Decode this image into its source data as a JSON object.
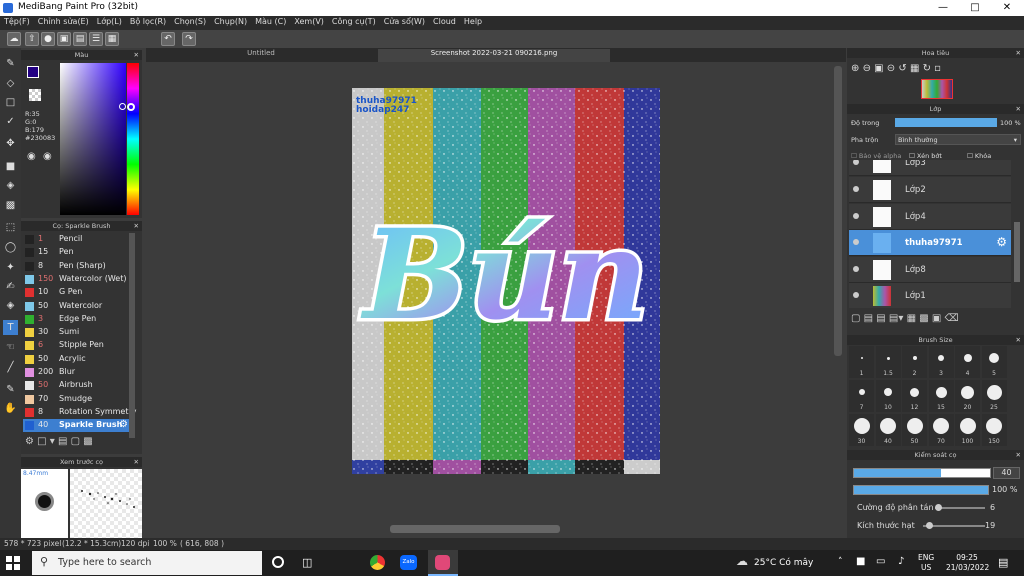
{
  "window": {
    "title": "MediBang Paint Pro (32bit)"
  },
  "menu": [
    "Tệp(F)",
    "Chỉnh sửa(E)",
    "Lớp(L)",
    "Bộ lọc(R)",
    "Chọn(S)",
    "Chụp(N)",
    "Màu (C)",
    "Xem(V)",
    "Công cụ(T)",
    "Cửa sổ(W)",
    "Cloud",
    "Help"
  ],
  "color_panel": {
    "title": "Màu",
    "r": "R:35",
    "g": "G:0",
    "b": "B:179",
    "hex": "#230083"
  },
  "brush_panel": {
    "title": "Cọ: Sparkle Brush",
    "items": [
      {
        "size": "1",
        "name": "Pencil",
        "color": "#222222"
      },
      {
        "size": "15",
        "name": "Pen",
        "color": "#222222"
      },
      {
        "size": "8",
        "name": "Pen (Sharp)",
        "color": "#222222"
      },
      {
        "size": "150",
        "name": "Watercolor (Wet)",
        "color": "#7ec8e8"
      },
      {
        "size": "10",
        "name": "G Pen",
        "color": "#e03030"
      },
      {
        "size": "50",
        "name": "Watercolor",
        "color": "#7ec8e8"
      },
      {
        "size": "3",
        "name": "Edge Pen",
        "color": "#30b030"
      },
      {
        "size": "30",
        "name": "Sumi",
        "color": "#f0d040"
      },
      {
        "size": "6",
        "name": "Stipple Pen",
        "color": "#f0d040"
      },
      {
        "size": "50",
        "name": "Acrylic",
        "color": "#f0d040"
      },
      {
        "size": "200",
        "name": "Blur",
        "color": "#e090e0"
      },
      {
        "size": "50",
        "name": "Airbrush",
        "color": "#e8e8e8"
      },
      {
        "size": "70",
        "name": "Smudge",
        "color": "#f0c8a0"
      },
      {
        "size": "8",
        "name": "Rotation Symmetry",
        "color": "#e03030"
      },
      {
        "size": "40",
        "name": "Sparkle Brush",
        "color": "#2060d0"
      }
    ]
  },
  "preview_panel": {
    "title": "Xem trước cọ",
    "size": "8.47mm"
  },
  "tabs": [
    "Untitled",
    "Screenshot 2022-03-21 090216.png"
  ],
  "canvas": {
    "credit1": "thuha97971",
    "credit2": "hoidap247",
    "word": "Bún"
  },
  "navigator": {
    "title": "Hoa tiêu"
  },
  "layer_panel": {
    "title": "Lớp",
    "opacity_label": "Độ trong",
    "opacity_value": "100 %",
    "blend_label": "Pha trộn",
    "blend_value": "Bình thường",
    "protect_alpha": "Bảo vệ alpha",
    "clip": "Xén bớt",
    "lock": "Khóa",
    "layers": [
      "Lớp3",
      "Lớp2",
      "Lớp4",
      "thuha97971",
      "Lớp8",
      "Lớp1"
    ]
  },
  "brush_size_panel": {
    "title": "Brush Size",
    "sizes": [
      "1",
      "1.5",
      "2",
      "3",
      "4",
      "5",
      "7",
      "10",
      "12",
      "15",
      "20",
      "25",
      "30",
      "40",
      "50",
      "70",
      "100",
      "150"
    ]
  },
  "control_panel": {
    "title": "Kiểm soát cọ",
    "size_value": "40",
    "opacity_value": "100 %",
    "scatter_label": "Cường độ phân tán",
    "scatter_value": "6",
    "particle_label": "Kích thước hạt",
    "particle_value": "19"
  },
  "status": {
    "dims": "578 * 723 pixel",
    "cm": "(12.2 * 15.3cm)",
    "dpi": "120 dpi",
    "zoom": "100 %",
    "coords": "( 616, 808 )"
  },
  "taskbar": {
    "search": "Type here to search",
    "weather": "25°C Có mây",
    "lang1": "ENG",
    "lang2": "US",
    "time": "09:25",
    "date": "21/03/2022"
  },
  "colors": {
    "accent": "#4a90d9",
    "selected": "#3d7fd0"
  }
}
